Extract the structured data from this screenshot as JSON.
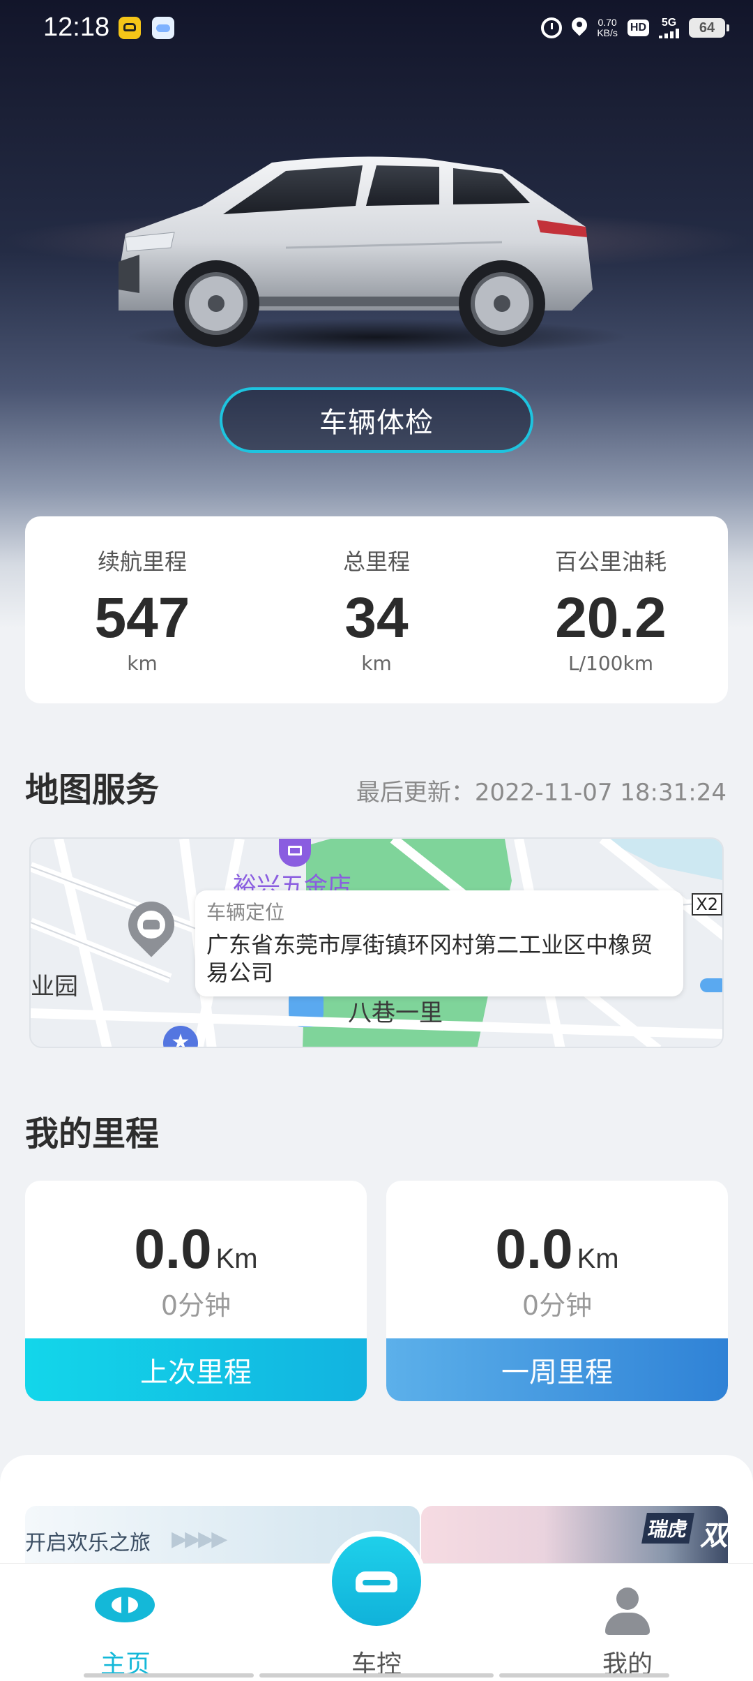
{
  "status_bar": {
    "time": "12:18",
    "net_speed_value": "0.70",
    "net_speed_unit": "KB/s",
    "hd": "HD",
    "network": "5G",
    "battery": "64"
  },
  "hero": {
    "check_button": "车辆体检"
  },
  "stats": [
    {
      "label": "续航里程",
      "value": "547",
      "unit": "km"
    },
    {
      "label": "总里程",
      "value": "34",
      "unit": "km"
    },
    {
      "label": "百公里油耗",
      "value": "20.2",
      "unit": "L/100km"
    }
  ],
  "map_section": {
    "title": "地图服务",
    "last_update": "最后更新：2022-11-07 18:31:24",
    "bubble_title": "车辆定位",
    "bubble_address": "广东省东莞市厚街镇环冈村第二工业区中橡贸易公司",
    "labels": {
      "poi_name": "裕兴五金店",
      "industrial": "业园",
      "street": "八巷一里",
      "road_badge": "X2"
    }
  },
  "mileage": {
    "title": "我的里程",
    "cards": [
      {
        "value": "0.0",
        "unit": "Km",
        "duration": "0分钟",
        "button": "上次里程"
      },
      {
        "value": "0.0",
        "unit": "Km",
        "duration": "0分钟",
        "button": "一周里程"
      }
    ]
  },
  "banners": {
    "left_text": "开启欢乐之旅",
    "right_brand": "瑞虎",
    "right_text": "双"
  },
  "tabbar": {
    "home": "主页",
    "control": "车控",
    "mine": "我的"
  },
  "colors": {
    "accent": "#14b8d8",
    "cyan_button": "#13d6ea",
    "blue_button": "#2f82d6"
  }
}
